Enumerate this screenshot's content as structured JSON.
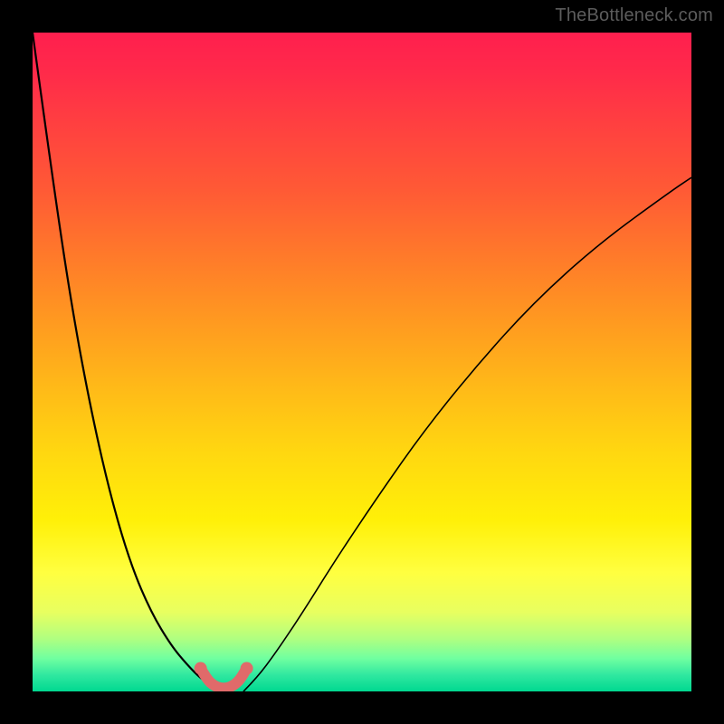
{
  "watermark": "TheBottleneck.com",
  "chart_data": {
    "type": "line",
    "title": "",
    "xlabel": "",
    "ylabel": "",
    "ylim": [
      0,
      100
    ],
    "series": [
      {
        "name": "left-curve",
        "x": [
          0.0,
          0.03,
          0.06,
          0.09,
          0.12,
          0.15,
          0.18,
          0.21,
          0.235,
          0.255,
          0.27,
          0.28
        ],
        "values": [
          100,
          78,
          58,
          42,
          29,
          19,
          12,
          7,
          4,
          2,
          1,
          0
        ]
      },
      {
        "name": "right-curve",
        "x": [
          0.32,
          0.34,
          0.37,
          0.41,
          0.46,
          0.52,
          0.59,
          0.67,
          0.76,
          0.86,
          0.97,
          1.0
        ],
        "values": [
          0,
          2,
          6,
          12,
          20,
          29,
          39,
          49,
          59,
          68,
          76,
          78
        ]
      },
      {
        "name": "bottom-marker",
        "x": [
          0.255,
          0.265,
          0.275,
          0.285,
          0.295,
          0.305,
          0.315,
          0.325
        ],
        "values": [
          3.5,
          1.8,
          0.9,
          0.5,
          0.5,
          0.9,
          1.8,
          3.5
        ]
      }
    ],
    "colors": {
      "curve": "#000000",
      "marker": "#e06a6a",
      "gradient_top": "#ff1f4e",
      "gradient_bottom": "#00d890"
    }
  }
}
